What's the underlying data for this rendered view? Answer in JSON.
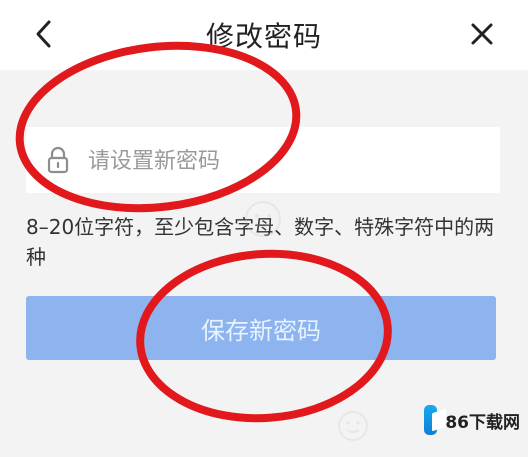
{
  "header": {
    "title": "修改密码",
    "back_icon": "chevron-left-icon",
    "close_icon": "close-icon"
  },
  "password_form": {
    "lock_icon": "lock-icon",
    "placeholder": "请设置新密码",
    "value": ""
  },
  "hint": {
    "text": "8–20位字符，至少包含字母、数字、特殊字符中的两种"
  },
  "save_button": {
    "label": "保存新密码"
  },
  "watermark": {
    "brand": "86下载网"
  },
  "colors": {
    "background": "#f3f3f3",
    "button": "#8db4ef",
    "button_text": "#e8f3ff",
    "annotation_red": "#e1181c",
    "watermark_blue": "#0b7fd6"
  }
}
